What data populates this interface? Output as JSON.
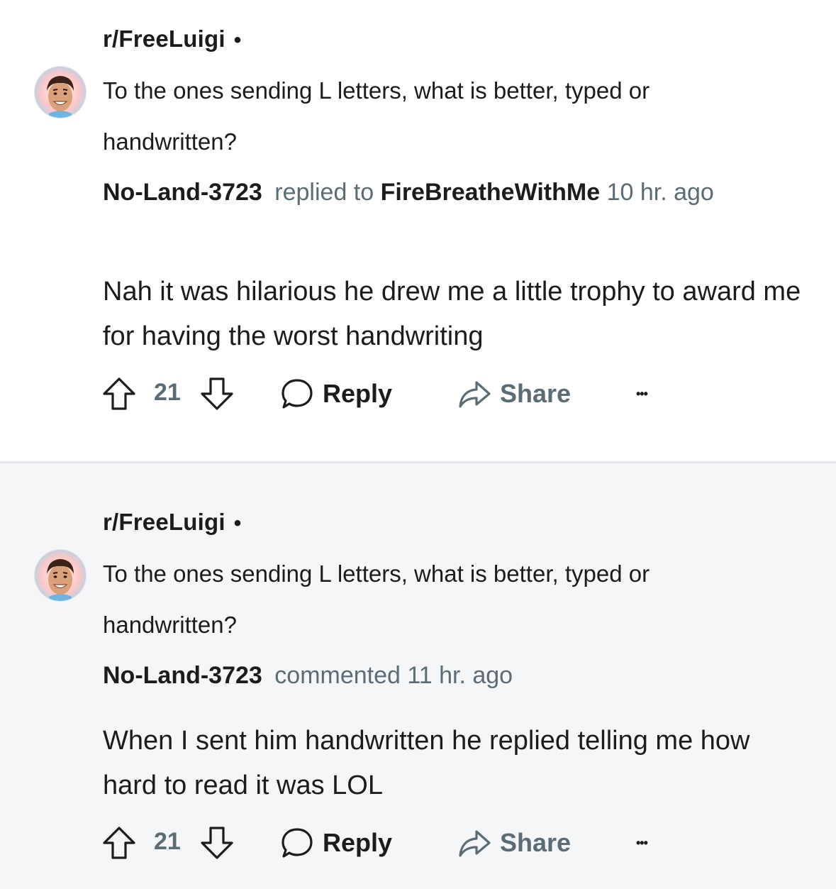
{
  "comments": [
    {
      "subreddit": "r/FreeLuigi",
      "separator": "•",
      "post_title": "To the ones sending L letters, what is better, typed or handwritten?",
      "author": "No-Land-3723",
      "action": "replied to",
      "reply_target": "FireBreatheWithMe",
      "time": "10 hr. ago",
      "body": "Nah it was hilarious he drew me a little trophy to award me for having the worst handwriting",
      "votes": "21",
      "reply_label": "Reply",
      "share_label": "Share",
      "more_label": "•••"
    },
    {
      "subreddit": "r/FreeLuigi",
      "separator": "•",
      "post_title": "To the ones sending L letters, what is better, typed or handwritten?",
      "author": "No-Land-3723",
      "action": "commented",
      "time": "11 hr. ago",
      "body": "When I sent him handwritten he replied telling me how hard to read it was LOL",
      "votes": "21",
      "reply_label": "Reply",
      "share_label": "Share",
      "more_label": "•••"
    }
  ],
  "colors": {
    "text": "#1c1c1c",
    "muted": "#5c6c74",
    "card_alt_bg": "#f5f6f8",
    "divider": "#e3e5e8"
  },
  "icons": [
    "avatar",
    "upvote-icon",
    "downvote-icon",
    "comment-bubble-icon",
    "share-arrow-icon",
    "more-options-icon"
  ]
}
